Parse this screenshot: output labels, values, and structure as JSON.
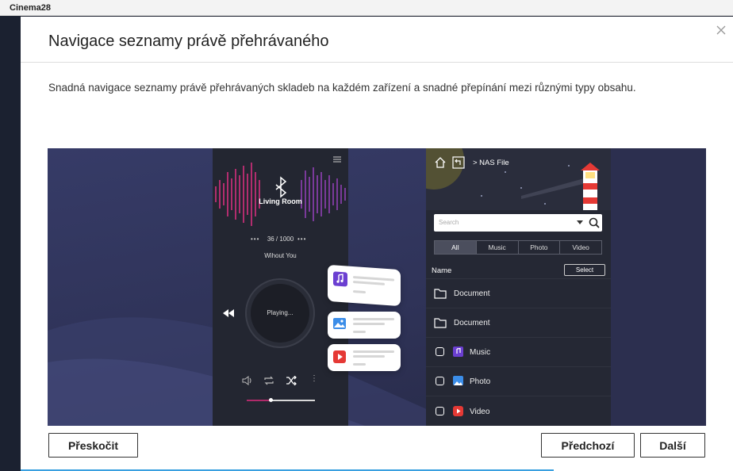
{
  "window": {
    "title": "Cinema28"
  },
  "dialog": {
    "title": "Navigace seznamy právě přehrávaného",
    "description": "Snadná navigace seznamy právě přehrávaných skladeb na každém zařízení a snadné přepínání mezi různými typy obsahu."
  },
  "player": {
    "device": "Living Room",
    "track_position": "36 / 1000",
    "track_title": "Wihout You",
    "state": "Playing..."
  },
  "browser": {
    "breadcrumb": "> NAS File",
    "search_placeholder": "Search",
    "tabs": [
      "All",
      "Music",
      "Photo",
      "Video"
    ],
    "active_tab": "All",
    "column_name": "Name",
    "select_label": "Select",
    "rows": [
      {
        "label": "Document",
        "icon": "folder-icon"
      },
      {
        "label": "Document",
        "icon": "folder-icon"
      },
      {
        "label": "Music",
        "icon": "music-icon"
      },
      {
        "label": "Photo",
        "icon": "photo-icon"
      },
      {
        "label": "Video",
        "icon": "video-icon"
      }
    ]
  },
  "buttons": {
    "skip": "Přeskočit",
    "previous": "Předchozí",
    "next": "Další"
  },
  "colors": {
    "accent_purple": "#6b3fd1",
    "accent_red": "#e53935",
    "photo_blue": "#3b8de8"
  }
}
